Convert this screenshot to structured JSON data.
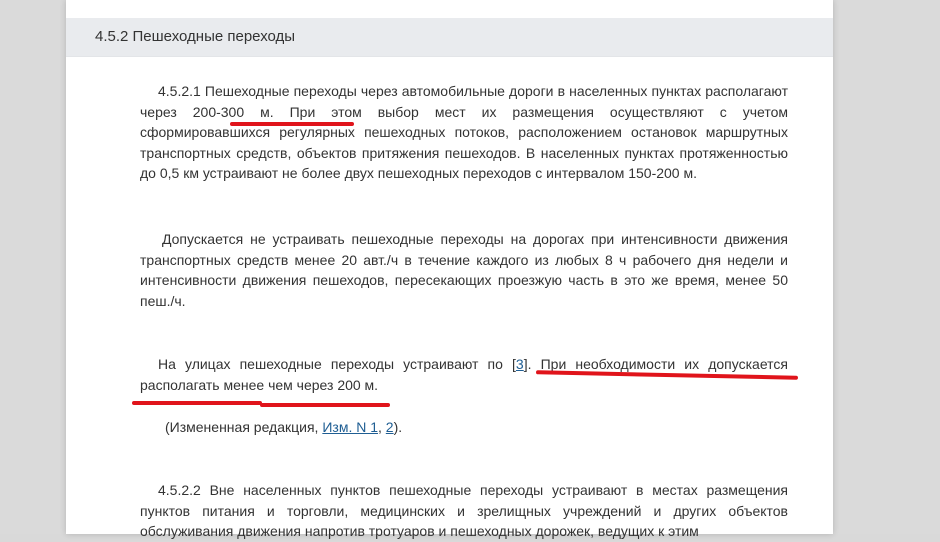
{
  "section": {
    "title": "4.5.2 Пешеходные переходы"
  },
  "p1": {
    "text_before": "4.5.2.1 Пешеходные переходы через автомобильные дороги в населенных пунктах располагают ",
    "highlight": "через 200-300 м",
    "text_after": ". При этом выбор мест их размещения осуществляют с учетом сформировавшихся регулярных пешеходных потоков, расположением остановок маршрутных транспортных средств, объектов притяжения пешеходов. В населенных пунктах протяженностью до 0,5 км устраивают не более двух пешеходных переходов с интервалом 150-200 м."
  },
  "p2": {
    "text": "Допускается не устраивать пешеходные переходы на дорогах при интенсивности движения транспортных средств менее 20 авт./ч в течение каждого из любых 8 ч рабочего дня недели и интенсивности движения пешеходов, пересекающих проезжую часть в это же время, менее 50 пеш./ч."
  },
  "p3": {
    "text_before": "На улицах пешеходные переходы устраивают по [",
    "ref": "3",
    "text_after": "]. При необходимости их допускается располагать менее чем через 200 м."
  },
  "p4": {
    "open": "(Измененная редакция, ",
    "link1": "Изм. N 1",
    "sep": ", ",
    "link2": "2",
    "close": ")."
  },
  "p5": {
    "text": "4.5.2.2 Вне населенных пунктов пешеходные переходы устраивают в местах размещения пунктов питания и торговли, медицинских и зрелищных учреждений и других объектов обслуживания движения напротив тротуаров и пешеходных дорожек, ведущих к этим"
  },
  "colors": {
    "underline": "#e0141b",
    "link": "#1f5e93",
    "text": "#333333",
    "section_bar": "#e9ebee"
  }
}
